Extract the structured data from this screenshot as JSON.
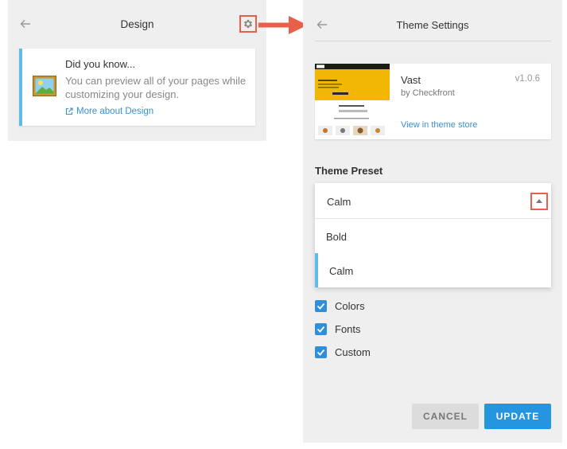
{
  "design_panel": {
    "title": "Design",
    "tip": {
      "heading": "Did you know...",
      "body": "You can preview all of your pages while customizing your design.",
      "link": "More about Design"
    }
  },
  "theme_settings": {
    "title": "Theme Settings",
    "theme": {
      "name": "Vast",
      "version": "v1.0.6",
      "author": "by Checkfront",
      "store_link": "View in theme store"
    },
    "preset": {
      "label": "Theme Preset",
      "selected": "Calm",
      "options": [
        "Bold",
        "Calm"
      ]
    },
    "checkboxes": [
      {
        "label": "Colors",
        "checked": true
      },
      {
        "label": "Fonts",
        "checked": true
      },
      {
        "label": "Custom",
        "checked": true
      }
    ],
    "buttons": {
      "cancel": "CANCEL",
      "update": "UPDATE"
    }
  },
  "colors": {
    "highlight": "#e8604c",
    "accent": "#2595e0",
    "tip_border": "#5bbde8"
  }
}
